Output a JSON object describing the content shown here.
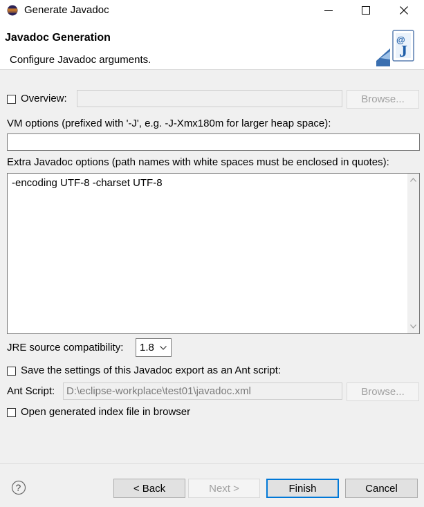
{
  "window": {
    "title": "Generate Javadoc"
  },
  "banner": {
    "title": "Javadoc Generation",
    "description": "Configure Javadoc arguments."
  },
  "overview": {
    "checkbox_label": "Overview:",
    "value": "",
    "browse_label": "Browse..."
  },
  "vm_options": {
    "label": "VM options (prefixed with '-J', e.g. -J-Xmx180m for larger heap space):",
    "value": ""
  },
  "extra_options": {
    "label": "Extra Javadoc options (path names with white spaces must be enclosed in quotes):",
    "value": "-encoding UTF-8 -charset UTF-8"
  },
  "jre": {
    "label": "JRE source compatibility:",
    "selected": "1.8"
  },
  "ant": {
    "save_label": "Save the settings of this Javadoc export as an Ant script:",
    "script_label": "Ant Script:",
    "script_value": "D:\\eclipse-workplace\\test01\\javadoc.xml",
    "browse_label": "Browse..."
  },
  "open_index": {
    "label": "Open generated index file in browser"
  },
  "buttons": {
    "back": "< Back",
    "next": "Next >",
    "finish": "Finish",
    "cancel": "Cancel"
  },
  "help_icon": "help-icon",
  "accent_color": "#0078d7"
}
